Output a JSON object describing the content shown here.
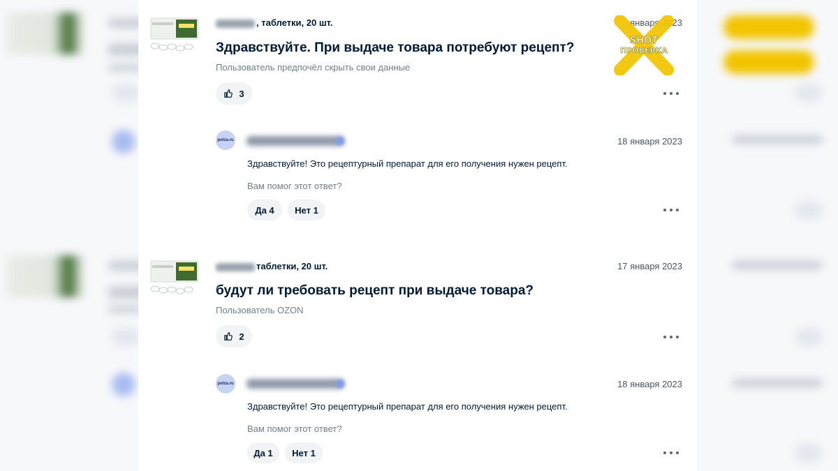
{
  "questions": [
    {
      "product": ", таблетки, 20 шт.",
      "date": "января 2023",
      "title": "Здравствуйте. При выдаче товара потребуют рецепт?",
      "author": "Пользователь предпочёл скрыть свои данные",
      "likes": "3",
      "answer": {
        "avatar_text": "polza.ru",
        "date": "18 января 2023",
        "text": "Здравствуйте! Это рецептурный препарат для его получения нужен рецепт.",
        "helpful_prompt": "Вам помог этот ответ?",
        "yes_label": "Да 4",
        "no_label": "Нет 1"
      }
    },
    {
      "product": "таблетки, 20 шт.",
      "date": "17 января 2023",
      "title": "будут ли требовать рецепт при выдаче товара?",
      "author": "Пользователь OZON",
      "likes": "2",
      "answer": {
        "avatar_text": "polza.ru",
        "date": "18 января 2023",
        "text": "Здравствуйте! Это рецептурный препарат для его получения нужен рецепт.",
        "helpful_prompt": "Вам помог этот ответ?",
        "yes_label": "Да 1",
        "no_label": "Нет 1"
      }
    }
  ],
  "watermark": {
    "line1": "SHOT",
    "line2": "ПРОВЕРКА",
    "color": "#f2c400"
  },
  "icons": {
    "like": "thumbs-up-icon",
    "more": "more-dots-icon"
  }
}
